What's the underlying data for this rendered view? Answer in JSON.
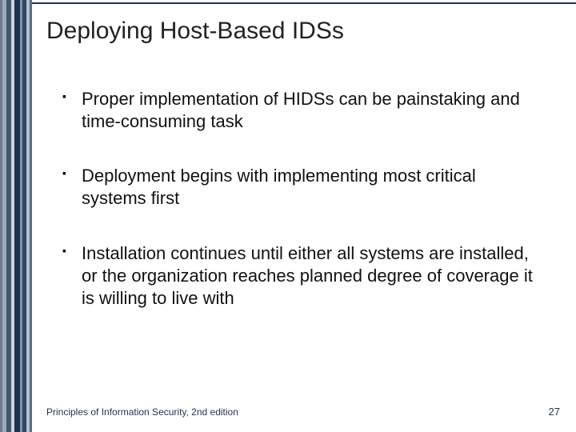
{
  "title": "Deploying Host-Based IDSs",
  "bullets": [
    "Proper implementation of HIDSs can be painstaking and time-consuming task",
    "Deployment begins with implementing most critical systems first",
    "Installation continues until either all systems are installed, or the organization reaches planned degree of coverage it is willing to live with"
  ],
  "footer": {
    "source": "Principles of Information Security, 2nd edition",
    "page": "27"
  },
  "decor": {
    "stripe_colors": [
      "#6d7d91",
      "#9faab8",
      "#405771",
      "#cfd5de",
      "#1c3354",
      "#8592a4",
      "#2f4765",
      "#b6bfcb",
      "#5a6c83"
    ],
    "stripe_widths": [
      3,
      5,
      6,
      4,
      7,
      3,
      5,
      4,
      3
    ]
  }
}
